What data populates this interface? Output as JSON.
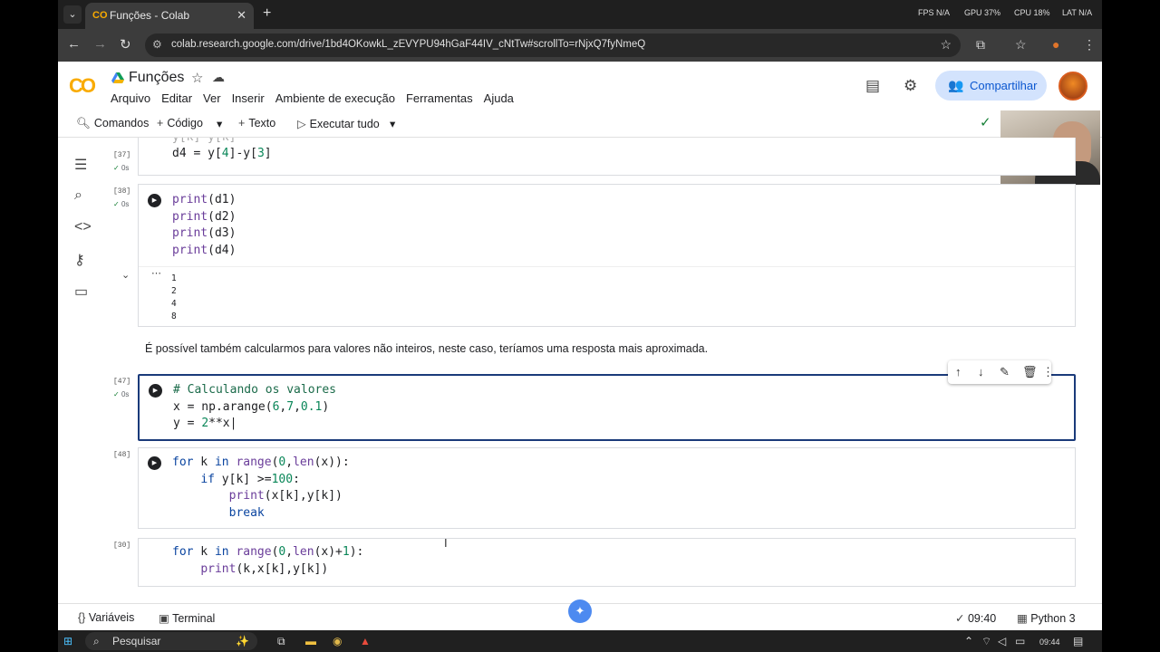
{
  "browser": {
    "tab_title": "Funções - Colab",
    "tab_favicon": "CO",
    "url": "colab.research.google.com/drive/1bd4OKowkL_zEVYPU94hGaF44IV_cNtTw#scrollTo=rNjxQ7fyNmeQ",
    "overlay": {
      "fps": "FPS N/A",
      "gpu": "GPU 37%",
      "cpu": "CPU 18%",
      "lat": "LAT N/A"
    }
  },
  "colab": {
    "logo": "CO",
    "doc_title": "Funções",
    "menu": [
      "Arquivo",
      "Editar",
      "Ver",
      "Inserir",
      "Ambiente de execução",
      "Ferramentas",
      "Ajuda"
    ],
    "share_label": "Compartilhar",
    "commands_label": "Comandos",
    "code_label": "Código",
    "text_label": "Texto",
    "run_all_label": "Executar tudo"
  },
  "cells": [
    {
      "exec": "[37]",
      "time": "0s"
    },
    {
      "exec": "[38]",
      "time": "0s",
      "output": [
        "1",
        "2",
        "4",
        "8"
      ]
    },
    {
      "exec": "[47]",
      "time": "0s"
    },
    {
      "exec": "[48]"
    },
    {
      "exec": "[30]"
    }
  ],
  "markdown": "É possível também calcularmos para valores não inteiros, neste caso, teríamos uma resposta mais aproximada.",
  "statusbar": {
    "variables": "Variáveis",
    "terminal": "Terminal",
    "time": "09:40",
    "runtime": "Python 3"
  },
  "taskbar": {
    "search": "Pesquisar",
    "clock": "09:44"
  }
}
